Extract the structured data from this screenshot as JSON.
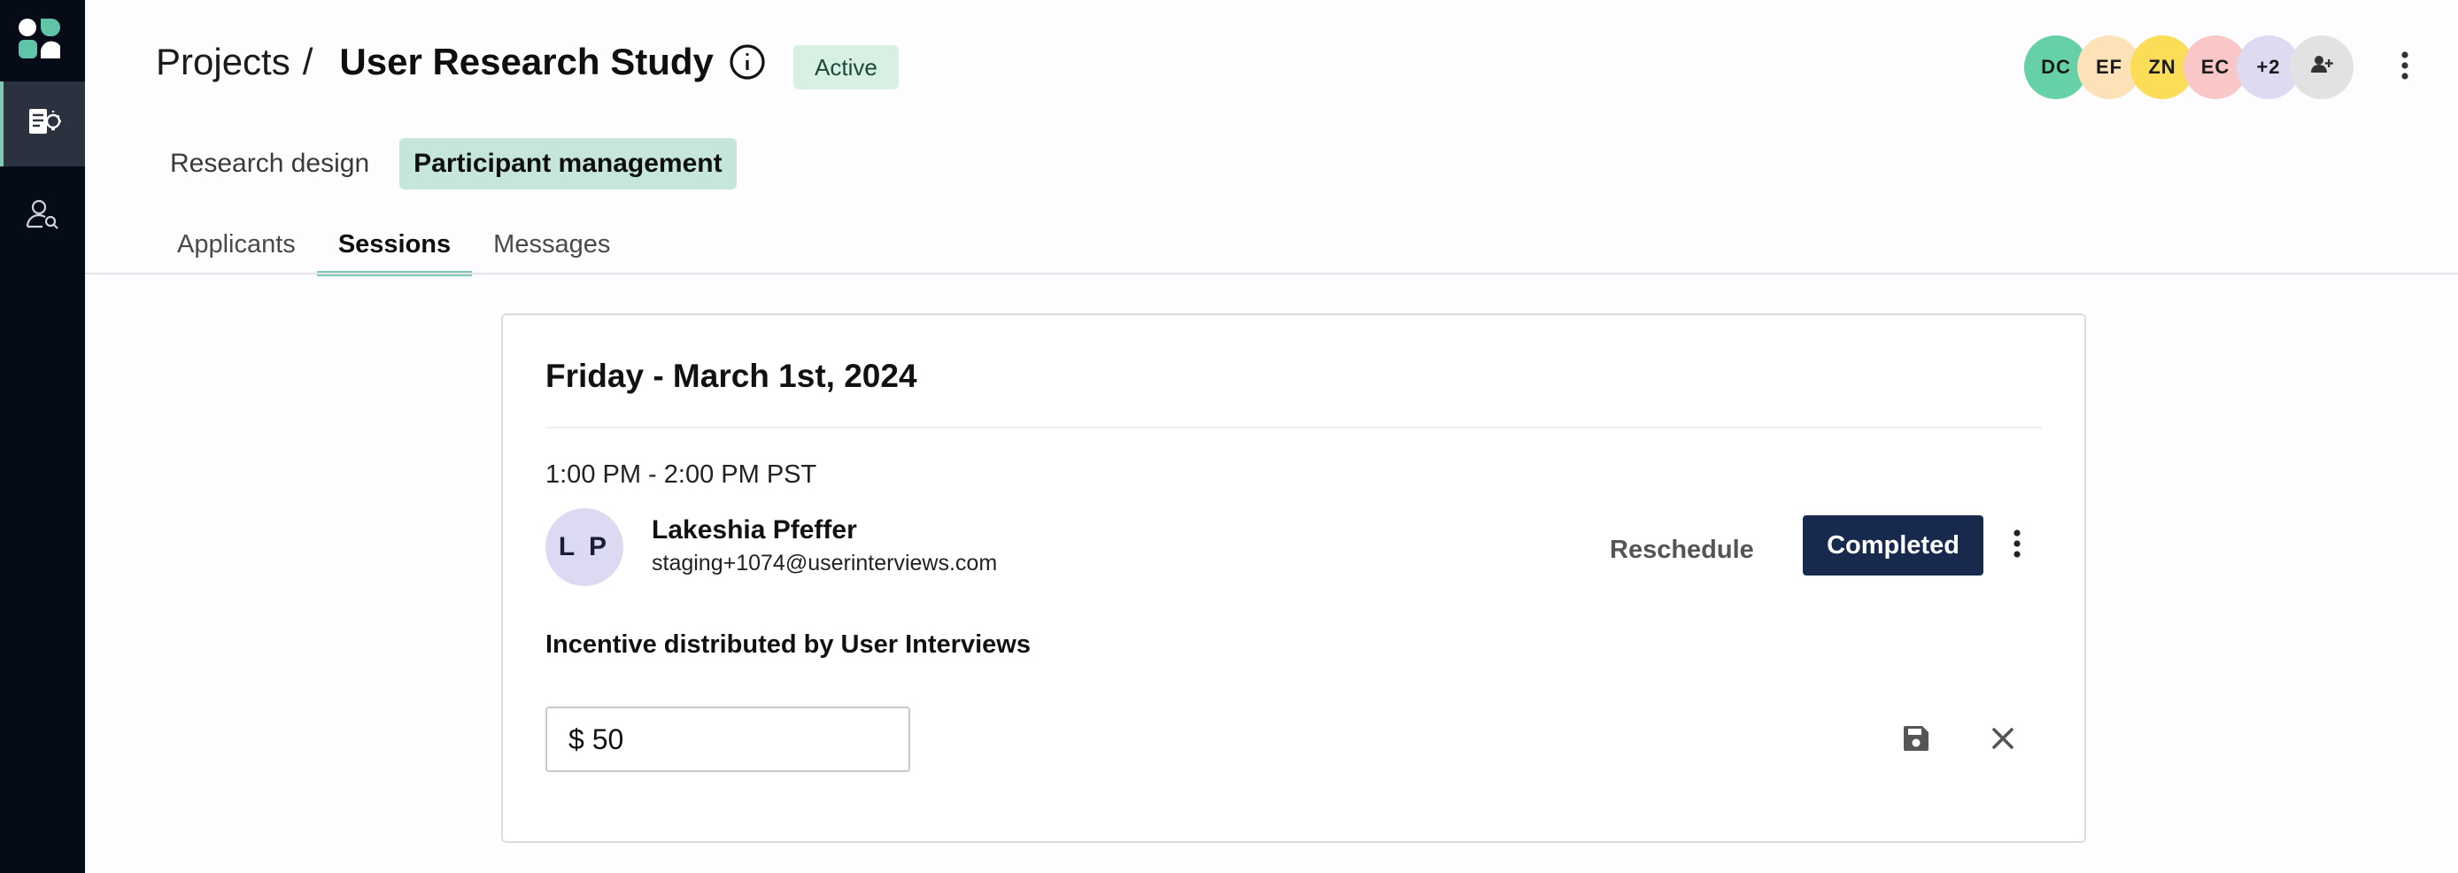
{
  "nav": {
    "items": [
      {
        "name": "research-studies",
        "icon": "document-lightbulb-icon",
        "active": true
      },
      {
        "name": "participants",
        "icon": "user-search-icon",
        "active": false
      }
    ]
  },
  "header": {
    "breadcrumb_root": "Projects",
    "breadcrumb_sep": "/",
    "title": "User Research Study",
    "status": "Active",
    "avatars": [
      {
        "initials": "DC",
        "color": "#66d1a8"
      },
      {
        "initials": "EF",
        "color": "#fde2b8"
      },
      {
        "initials": "ZN",
        "color": "#fbdd58"
      },
      {
        "initials": "EC",
        "color": "#f9c7c7"
      },
      {
        "initials": "+2",
        "color": "#dedaf2"
      }
    ],
    "add_user_icon": "user-plus-icon",
    "more_icon": "kebab-vertical-icon"
  },
  "primary_tabs": [
    {
      "label": "Research design",
      "active": false
    },
    {
      "label": "Participant management",
      "active": true
    }
  ],
  "secondary_tabs": [
    {
      "label": "Applicants",
      "active": false
    },
    {
      "label": "Sessions",
      "active": true
    },
    {
      "label": "Messages",
      "active": false
    }
  ],
  "session": {
    "date": "Friday - March 1st, 2024",
    "time": "1:00 PM - 2:00 PM PST",
    "participant": {
      "initials": "L P",
      "name": "Lakeshia Pfeffer",
      "email": "staging+1074@userinterviews.com"
    },
    "reschedule_label": "Reschedule",
    "status_button": "Completed",
    "incentive_label": "Incentive distributed by User Interviews",
    "amount": "$ 50"
  },
  "colors": {
    "sidebar": "#060c17",
    "accent": "#7fc8b6",
    "primary_button": "#172a4e",
    "active_badge": "#d8f0e4"
  }
}
